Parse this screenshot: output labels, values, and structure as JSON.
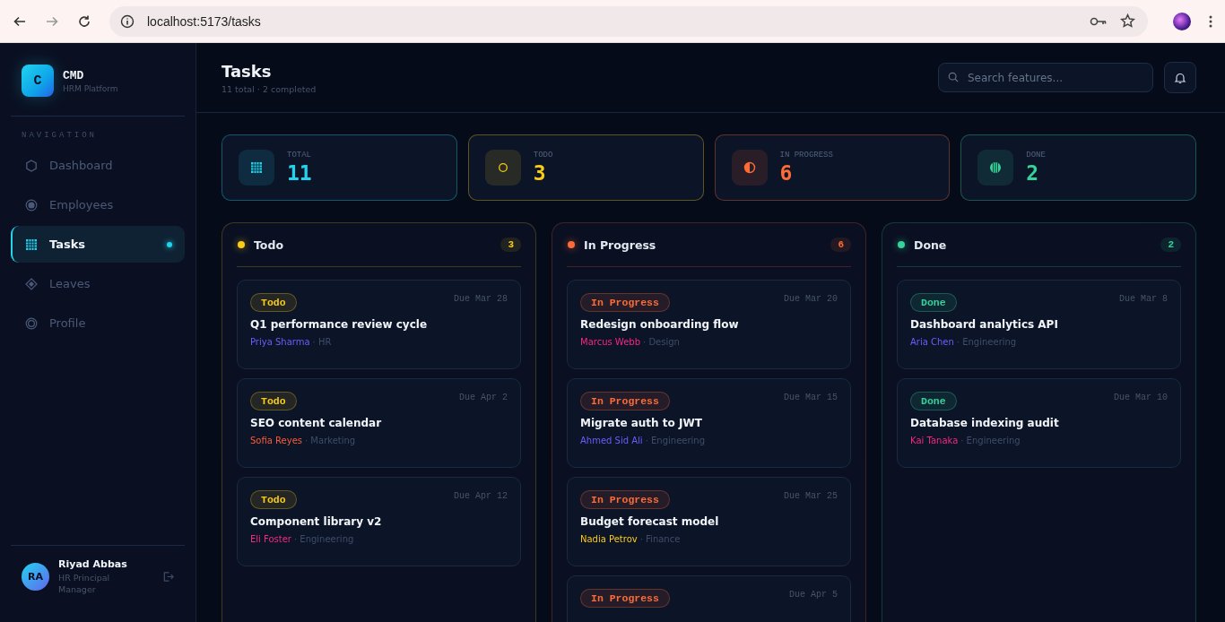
{
  "browser": {
    "url": "localhost:5173/tasks"
  },
  "sidebar": {
    "logo_letter": "C",
    "brand": "CMD",
    "subtitle": "HRM Platform",
    "section": "NAVIGATION",
    "items": [
      {
        "label": "Dashboard",
        "kind": "hexagon",
        "selected": false
      },
      {
        "label": "Employees",
        "kind": "radio",
        "selected": false
      },
      {
        "label": "Tasks",
        "kind": "grid",
        "selected": true
      },
      {
        "label": "Leaves",
        "kind": "diamond",
        "selected": false
      },
      {
        "label": "Profile",
        "kind": "ring",
        "selected": false
      }
    ],
    "user": {
      "initials": "RA",
      "name": "Riyad Abbas",
      "role": "HR Principal Manager"
    }
  },
  "header": {
    "title": "Tasks",
    "subtitle": "11 total · 2 completed",
    "search": {
      "placeholder": "Search features..."
    }
  },
  "stats": [
    {
      "label": "TOTAL",
      "value": "11",
      "kind": "grid",
      "color": "#22d3ee"
    },
    {
      "label": "TODO",
      "value": "3",
      "kind": "circle",
      "color": "#facc15"
    },
    {
      "label": "IN PROGRESS",
      "value": "6",
      "kind": "half",
      "color": "#ff6b35"
    },
    {
      "label": "DONE",
      "value": "2",
      "kind": "striped",
      "color": "#34d399"
    }
  ],
  "columns": [
    {
      "title": "Todo",
      "count": "3",
      "color": "#facc15",
      "cards": [
        {
          "status": "Todo",
          "due": "Due Mar 28",
          "title": "Q1 performance review cycle",
          "assignee": "Priya Sharma",
          "color": "#6d5cff",
          "department": "· HR"
        },
        {
          "status": "Todo",
          "due": "Due Apr 2",
          "title": "SEO content calendar",
          "assignee": "Sofia Reyes",
          "color": "#ff5a36",
          "department": "· Marketing"
        },
        {
          "status": "Todo",
          "due": "Due Apr 12",
          "title": "Component library v2",
          "assignee": "Eli Foster",
          "color": "#f72585",
          "department": "· Engineering"
        }
      ]
    },
    {
      "title": "In Progress",
      "count": "6",
      "color": "#ff6b35",
      "cards": [
        {
          "status": "In Progress",
          "due": "Due Mar 20",
          "title": "Redesign onboarding flow",
          "assignee": "Marcus Webb",
          "color": "#f72585",
          "department": "· Design"
        },
        {
          "status": "In Progress",
          "due": "Due Mar 15",
          "title": "Migrate auth to JWT",
          "assignee": "Ahmed Sid Ali",
          "color": "#6d5cff",
          "department": "· Engineering"
        },
        {
          "status": "In Progress",
          "due": "Due Mar 25",
          "title": "Budget forecast model",
          "assignee": "Nadia Petrov",
          "color": "#facc15",
          "department": "· Finance"
        },
        {
          "status": "In Progress",
          "due": "Due Apr 5"
        }
      ]
    },
    {
      "title": "Done",
      "count": "2",
      "color": "#34d399",
      "cards": [
        {
          "status": "Done",
          "due": "Due Mar 8",
          "title": "Dashboard analytics API",
          "assignee": "Aria Chen",
          "color": "#6d5cff",
          "department": "· Engineering"
        },
        {
          "status": "Done",
          "due": "Due Mar 10",
          "title": "Database indexing audit",
          "assignee": "Kai Tanaka",
          "color": "#f72585",
          "department": "· Engineering"
        }
      ]
    }
  ]
}
